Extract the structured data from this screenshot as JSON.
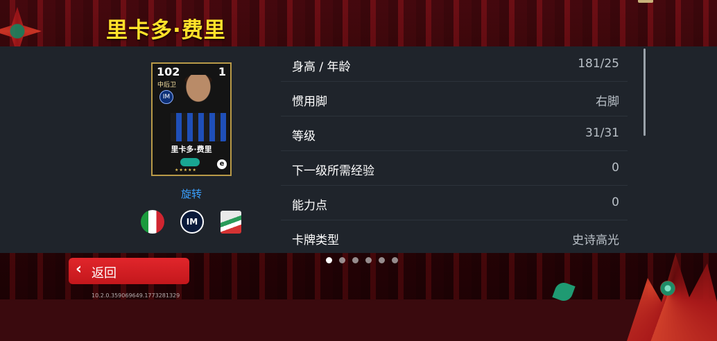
{
  "header": {
    "title": "里卡多·费里"
  },
  "card": {
    "rating": "102",
    "level": "1",
    "position": "中后卫",
    "club_badge": "IM",
    "name": "里卡多·费里",
    "stars": "★★★★★",
    "efootball_logo": "e"
  },
  "rotate_label": "旋转",
  "badges": [
    {
      "name": "italy-flag-icon"
    },
    {
      "name": "inter-badge-icon",
      "text": "IM"
    },
    {
      "name": "serie-a-badge-icon"
    }
  ],
  "stats": [
    {
      "label": "身高 / 年龄",
      "value": "181/25"
    },
    {
      "label": "惯用脚",
      "value": "右脚"
    },
    {
      "label": "等级",
      "value": "31/31"
    },
    {
      "label": "下一级所需经验",
      "value": "0"
    },
    {
      "label": "能力点",
      "value": "0"
    },
    {
      "label": "卡牌类型",
      "value": "史诗高光"
    }
  ],
  "pagination": {
    "total": 6,
    "current": 1
  },
  "back_button": {
    "label": "返回",
    "icon": "chevron-left-icon"
  },
  "version": "10.2.0.359069649.1773281329",
  "colors": {
    "title": "#ffe22a",
    "panel": "#1f242b",
    "back_button": "#d41f24",
    "rotate_link": "#3aa0ff"
  }
}
